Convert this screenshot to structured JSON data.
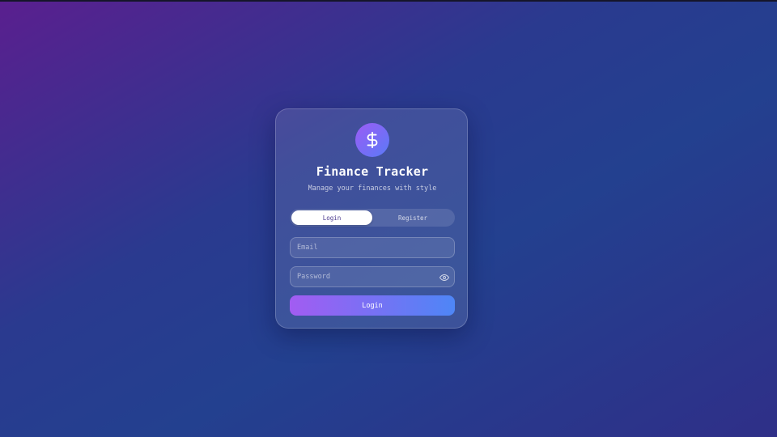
{
  "app": {
    "title": "Finance Tracker",
    "subtitle": "Manage your finances with style",
    "logo_symbol": "$",
    "logo_icon": "dollar-sign-icon"
  },
  "tabs": [
    {
      "label": "Login",
      "active": true
    },
    {
      "label": "Register",
      "active": false
    }
  ],
  "form": {
    "email": {
      "value": "",
      "placeholder": "Email"
    },
    "password": {
      "value": "",
      "placeholder": "Password",
      "toggle_icon": "eye-icon"
    },
    "submit_label": "Login"
  },
  "colors": {
    "accent_start": "#a25cf2",
    "accent_end": "#4e86f6",
    "background_start": "#5a1f8f",
    "background_end": "#23408f"
  }
}
